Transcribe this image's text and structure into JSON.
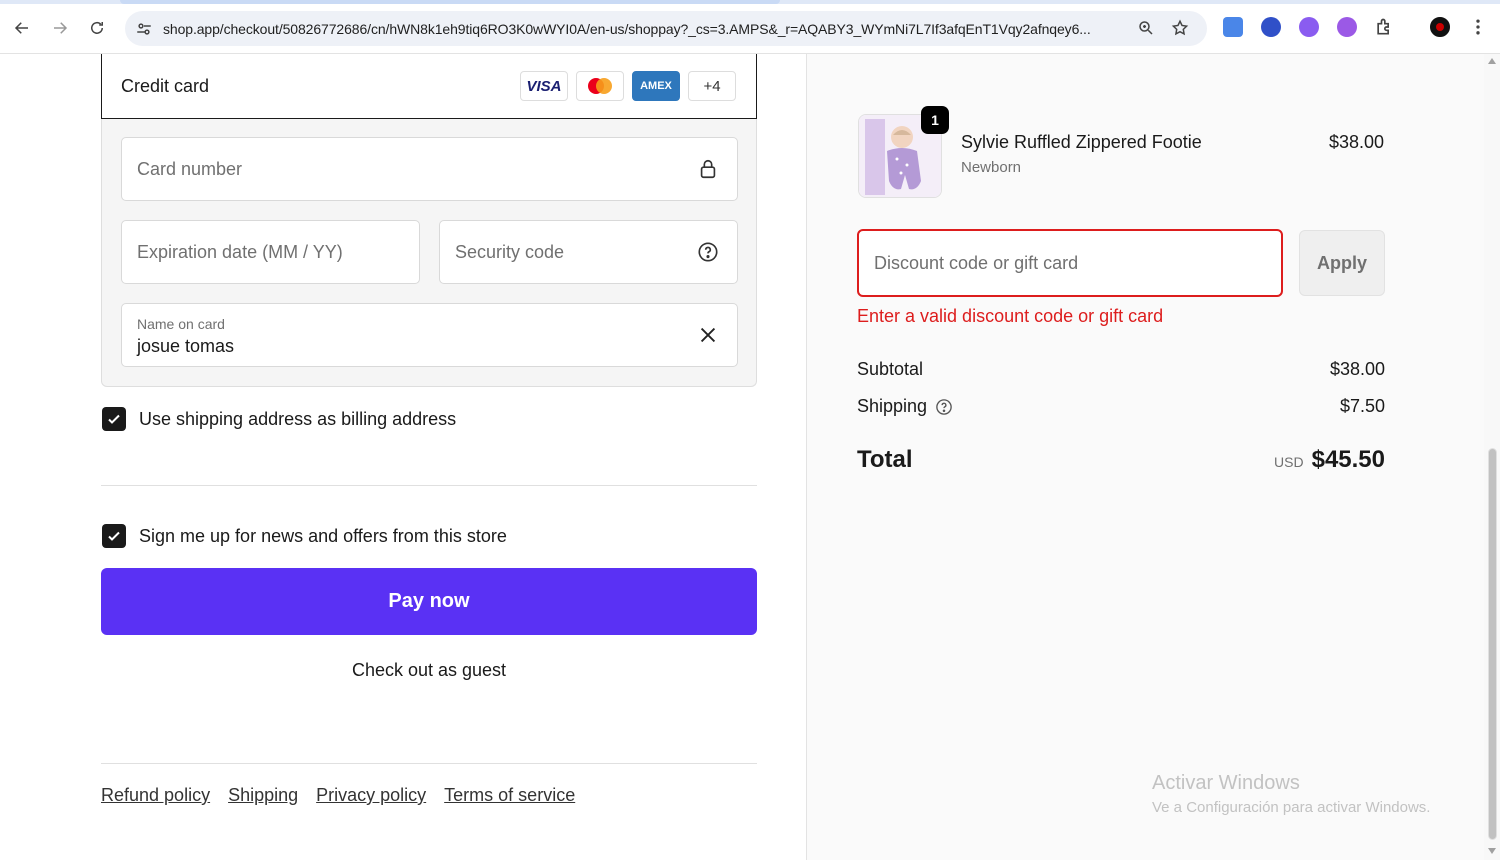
{
  "browser": {
    "url": "shop.app/checkout/50826772686/cn/hWN8k1eh9tiq6RO3K0wWYI0A/en-us/shoppay?_cs=3.AMPS&_r=AQABY3_WYmNi7L7If3afqEnT1Vqy2afnqey6..."
  },
  "payment": {
    "method_label": "Credit card",
    "logos": [
      "VISA",
      "AMEX",
      "+4"
    ],
    "card_number_placeholder": "Card number",
    "expiration_placeholder": "Expiration date (MM / YY)",
    "security_code_placeholder": "Security code",
    "name_label": "Name on card",
    "name_value": "josue tomas"
  },
  "options": {
    "billing_same_label": "Use shipping address as billing address",
    "newsletter_label": "Sign me up for news and offers from this store"
  },
  "actions": {
    "pay_now": "Pay now",
    "guest": "Check out as guest"
  },
  "footer": {
    "refund": "Refund policy",
    "shipping": "Shipping",
    "privacy": "Privacy policy",
    "terms": "Terms of service"
  },
  "summary": {
    "item": {
      "quantity": "1",
      "name": "Sylvie Ruffled Zippered Footie",
      "variant": "Newborn",
      "price": "$38.00"
    },
    "discount_placeholder": "Discount code or gift card",
    "apply_label": "Apply",
    "error": "Enter a valid discount code or gift card",
    "subtotal_label": "Subtotal",
    "subtotal_value": "$38.00",
    "shipping_label": "Shipping",
    "shipping_value": "$7.50",
    "total_label": "Total",
    "currency": "USD",
    "total_value": "$45.50"
  },
  "watermark": {
    "title": "Activar Windows",
    "subtitle": "Ve a Configuración para activar Windows."
  },
  "colors": {
    "accent": "#5a31f4",
    "error": "#dd1d1d"
  }
}
